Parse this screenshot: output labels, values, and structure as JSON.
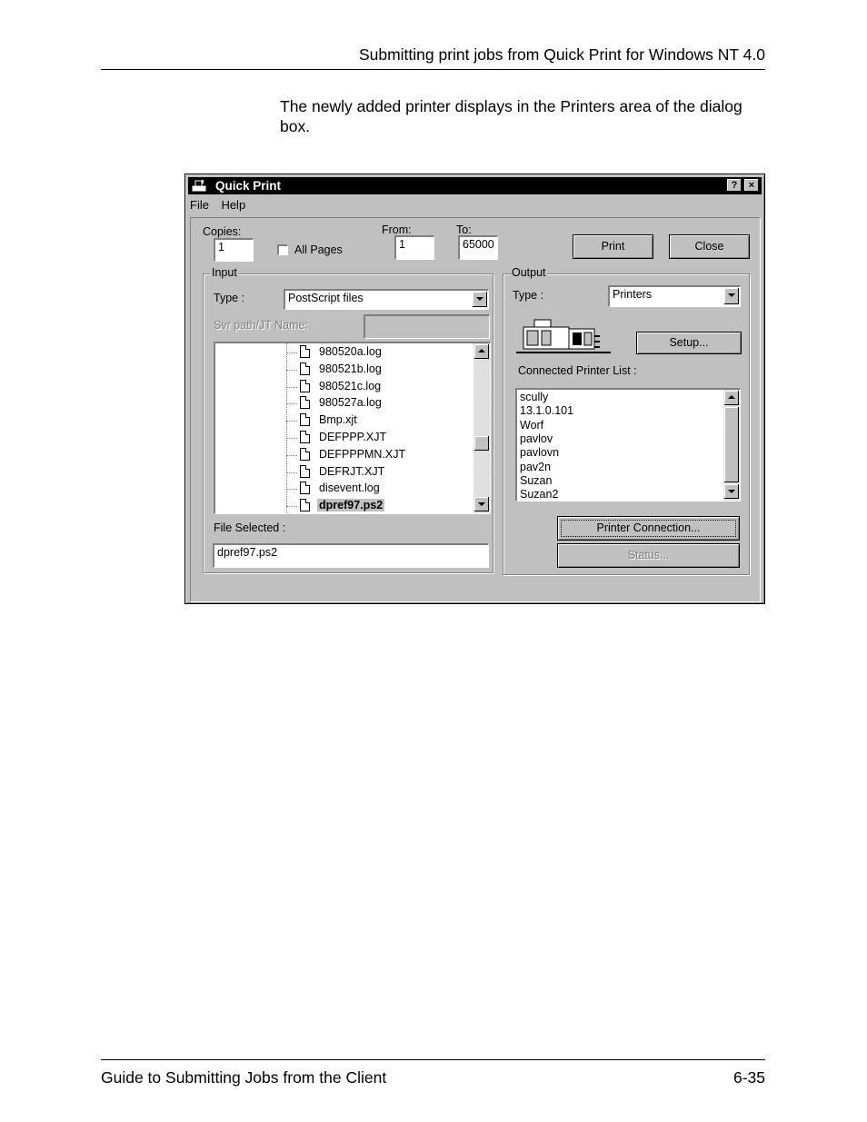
{
  "page": {
    "header": "Submitting print jobs from Quick Print for Windows NT 4.0",
    "intro": "The newly added printer displays in the Printers area of the dialog box.",
    "footer_left": "Guide to Submitting Jobs from the Client",
    "footer_right": "6-35"
  },
  "dialog": {
    "title": "Quick Print",
    "help_btn": "?",
    "close_btn": "×",
    "menu": {
      "file": "File",
      "help": "Help"
    },
    "copies_label": "Copies:",
    "copies_value": "1",
    "all_pages_label": "All Pages",
    "from_label": "From:",
    "from_value": "1",
    "to_label": "To:",
    "to_value": "65000",
    "print_btn": "Print",
    "close_button": "Close",
    "input": {
      "group_label": "Input",
      "type_label": "Type :",
      "type_value": "PostScript files",
      "svr_label": "Svr path/JT Name:",
      "files": [
        "980520a.log",
        "980521b.log",
        "980521c.log",
        "980527a.log",
        "Bmp.xjt",
        "DEFPPP.XJT",
        "DEFPPPMN.XJT",
        "DEFRJT.XJT",
        "disevent.log",
        "dpref97.ps2"
      ],
      "file_selected_label": "File Selected :",
      "file_selected_value": "dpref97.ps2"
    },
    "output": {
      "group_label": "Output",
      "type_label": "Type :",
      "type_value": "Printers",
      "setup_btn": "Setup...",
      "printer_list_label": "Connected Printer List :",
      "printers": [
        "scully",
        "13.1.0.101",
        "Worf",
        "pavlov",
        "pavlovn",
        "pav2n",
        "Suzan",
        "Suzan2"
      ],
      "printer_connection_btn": "Printer Connection...",
      "status_btn": "Status..."
    }
  }
}
